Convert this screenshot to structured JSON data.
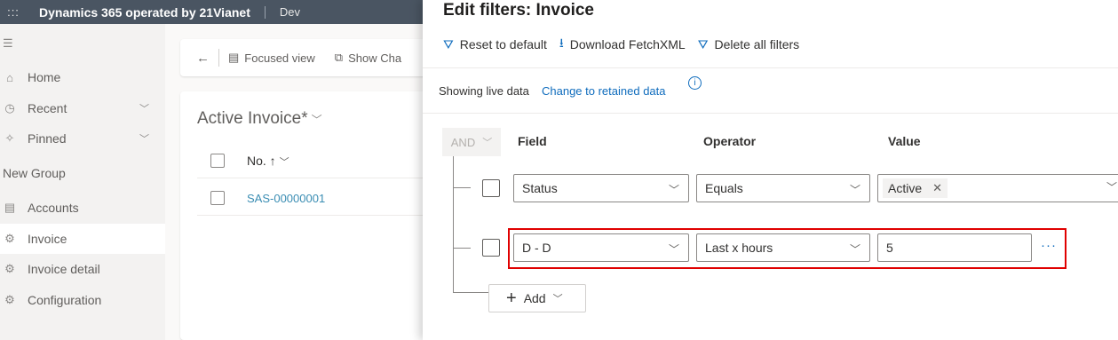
{
  "topbar": {
    "waffle_glyph": ":::",
    "app_title": "Dynamics 365 operated by 21Vianet",
    "environment": "Dev"
  },
  "sidebar": {
    "items": [
      {
        "label": "Home",
        "icon": "home-icon",
        "glyph": "⌂"
      },
      {
        "label": "Recent",
        "icon": "clock-icon",
        "glyph": "◷"
      },
      {
        "label": "Pinned",
        "icon": "pin-icon",
        "glyph": "✧"
      }
    ],
    "group_label": "New Group",
    "group_items": [
      {
        "label": "Accounts",
        "icon": "accounts-icon",
        "glyph": "▤"
      },
      {
        "label": "Invoice",
        "icon": "gear-icon",
        "glyph": "⚙"
      },
      {
        "label": "Invoice detail",
        "icon": "gear-icon",
        "glyph": "⚙"
      },
      {
        "label": "Configuration",
        "icon": "gear-icon",
        "glyph": "⚙"
      }
    ]
  },
  "main": {
    "commands": {
      "focused_view": "Focused view",
      "show_chart": "Show Cha"
    },
    "view_title": "Active Invoice*",
    "column_header": "No. ↑",
    "rows": [
      "SAS-00000001"
    ]
  },
  "panel": {
    "title": "Edit filters: Invoice",
    "toolbar": {
      "reset": "Reset to default",
      "download": "Download FetchXML",
      "delete": "Delete all filters"
    },
    "live_text": "Showing live data",
    "live_link": "Change to retained data",
    "logic_operator": "AND",
    "headers": {
      "field": "Field",
      "operator": "Operator",
      "value": "Value"
    },
    "conditions": [
      {
        "field": "Status",
        "operator": "Equals",
        "value": "Active"
      },
      {
        "field": "D - D",
        "operator": "Last x hours",
        "value": "5"
      }
    ],
    "add_label": "Add"
  },
  "colors": {
    "topbar": "#4a5562",
    "accent": "#0f6cbd",
    "highlight_border": "#e00000",
    "link": "#3a8db3"
  }
}
